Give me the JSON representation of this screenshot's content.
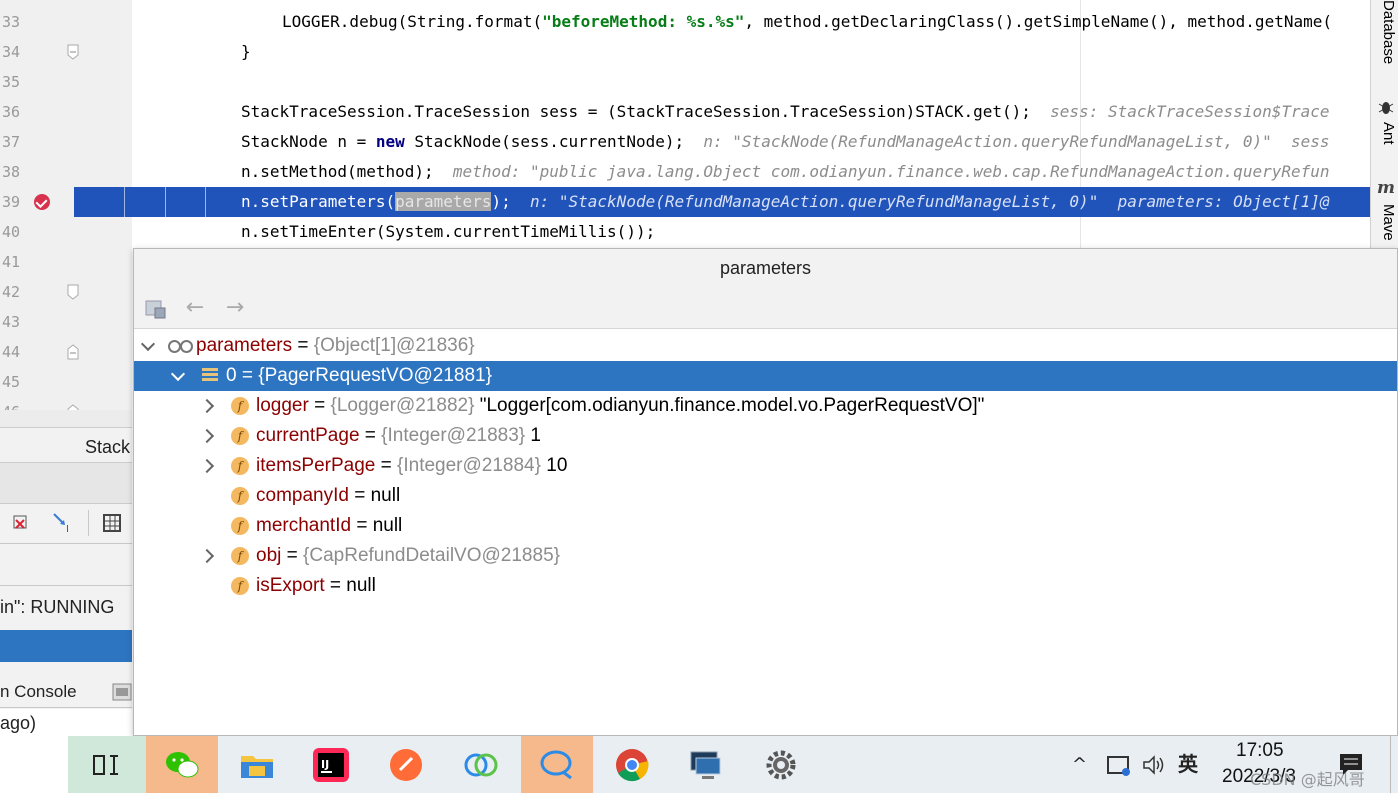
{
  "editor": {
    "lines": [
      {
        "num": "33",
        "code_prefix": "LOGGER.debug(String.format(",
        "code_string": "\"beforeMethod: %s.%s\"",
        "code_suffix": ", method.getDeclaringClass().getSimpleName(), method.getName(",
        "hint": ""
      },
      {
        "num": "34",
        "code": "}",
        "hint": ""
      },
      {
        "num": "35",
        "code": "",
        "hint": ""
      },
      {
        "num": "36",
        "code": "StackTraceSession.TraceSession sess = (StackTraceSession.TraceSession)STACK.get();",
        "hint": "sess: StackTraceSession$Trace"
      },
      {
        "num": "37",
        "code_prefix": "StackNode n = ",
        "code_kw": "new",
        "code_suffix": " StackNode(sess.currentNode);",
        "hint": "n: \"StackNode(RefundManageAction.queryRefundManageList, 0)\"  sess"
      },
      {
        "num": "38",
        "code": "n.setMethod(method);",
        "hint": "method: \"public java.lang.Object com.odianyun.finance.web.cap.RefundManageAction.queryRefun"
      },
      {
        "num": "39",
        "code_prefix": "n.setParameters(",
        "code_sel": "parameters",
        "code_suffix": ");",
        "hint": "n: \"StackNode(RefundManageAction.queryRefundManageList, 0)\"  parameters: Object[1]@"
      },
      {
        "num": "40",
        "code": "n.setTimeEnter(System.currentTimeMillis());",
        "hint": ""
      },
      {
        "num": "41",
        "code": "",
        "hint": ""
      },
      {
        "num": "42",
        "code": "",
        "hint": ""
      },
      {
        "num": "43",
        "code": "",
        "hint": ""
      },
      {
        "num": "44",
        "code": "",
        "hint": ""
      },
      {
        "num": "45",
        "code": "",
        "hint": ""
      },
      {
        "num": "46",
        "code": "",
        "hint": ""
      }
    ]
  },
  "right_strip": {
    "tabs": [
      "Database",
      "Ant",
      "Mave"
    ]
  },
  "left_panel": {
    "stack_label": "Stack",
    "running_text": "in\": RUNNING",
    "console_label": "n Console",
    "ago_text": "ago)"
  },
  "popup": {
    "title": "parameters",
    "root": {
      "name": "parameters",
      "eq": " = ",
      "type": "{Object[1]@21836}"
    },
    "element": {
      "name": "0",
      "eq": " = ",
      "type": "{PagerRequestVO@21881}"
    },
    "fields": [
      {
        "name": "logger",
        "type": "{Logger@21882}",
        "value": " \"Logger[com.odianyun.finance.model.vo.PagerRequestVO]\"",
        "expandable": true
      },
      {
        "name": "currentPage",
        "type": "{Integer@21883}",
        "value": " 1",
        "expandable": true
      },
      {
        "name": "itemsPerPage",
        "type": "{Integer@21884}",
        "value": " 10",
        "expandable": true
      },
      {
        "name": "companyId",
        "type": "",
        "value": "null",
        "expandable": false
      },
      {
        "name": "merchantId",
        "type": "",
        "value": "null",
        "expandable": false
      },
      {
        "name": "obj",
        "type": "{CapRefundDetailVO@21885}",
        "value": "",
        "expandable": true
      },
      {
        "name": "isExport",
        "type": "",
        "value": "null",
        "expandable": false
      }
    ]
  },
  "taskbar": {
    "input_method": "英",
    "time": "17:05",
    "date": "2022/3/3",
    "watermark": "CSDN @起风哥",
    "apps": [
      "task-view",
      "wechat",
      "file-explorer",
      "intellij-idea",
      "postman",
      "app-blue",
      "chat-app",
      "chrome",
      "remote-desktop",
      "settings"
    ]
  },
  "colors": {
    "current_line": "#2154bb",
    "selected_row": "#2e75c1",
    "field_icon": "#f4b860",
    "string_literal": "#067d17",
    "keyword": "#000080"
  }
}
